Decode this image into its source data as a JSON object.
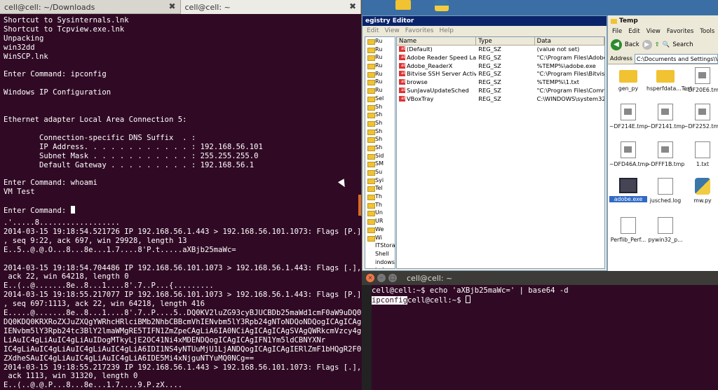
{
  "term1": {
    "tabs": [
      {
        "label": "cell@cell: ~/Downloads"
      },
      {
        "label": "cell@cell: ~"
      }
    ],
    "lines": [
      "Shortcut to Sysinternals.lnk",
      "Shortcut to Tcpview.exe.lnk",
      "Unpacking",
      "win32dd",
      "WinSCP.lnk",
      "",
      "Enter Command: ipconfig",
      "",
      "Windows IP Configuration",
      "",
      "",
      "Ethernet adapter Local Area Connection 5:",
      "",
      "        Connection-specific DNS Suffix  . :",
      "        IP Address. . . . . . . . . . . . : 192.168.56.101",
      "        Subnet Mask . . . . . . . . . . . : 255.255.255.0",
      "        Default Gateway . . . . . . . . . : 192.168.56.1",
      "",
      "Enter Command: whoami",
      "VM Test",
      "",
      "Enter Command: "
    ]
  },
  "term2": {
    "lines": [
      ".'.....8..................",
      "2014-03-15 19:18:54.521726 IP 192.168.56.1.443 > 192.168.56.101.1073: Flags [P.]",
      ", seq 9:22, ack 697, win 29928, length 13",
      "E..5..@.@.O...8...8e...1.7....8'P.t.....aXBjb25maWc=",
      "",
      "2014-03-15 19:18:54.704486 IP 192.168.56.101.1073 > 192.168.56.1.443: Flags [.],",
      " ack 22, win 64218, length 0",
      "E..(..@.......8e..8...1....8'.7..P...{.........",
      "2014-03-15 19:18:55.217077 IP 192.168.56.101.1073 > 192.168.56.1.443: Flags [P.]",
      ", seq 697:1113, ack 22, win 64218, length 416",
      "E.....@.......8e..8...1....8'.7..P....5..DQ0KV2luZG93cyBJUCBDb25maWd1cmF0aW9uDQ0K",
      "DQ0KDQ0KRXRoZXJuZXQgYWRhcHRlciBMb2NhbCBBcmVhIENvbm5lY3Rpb24gNToNDQoNDQogICAgICAg",
      "IENvbm5lY3Rpb24tc3BlY2lmaWMgRE5TIFN1ZmZpeCAgLiA6IA0NCiAgICAgICAgSVAgQWRkcmVzcy4g",
      "LiAuIC4gLiAuIC4gLiAuIDogMTkyLjE2OC41Ni4xMDENDQogICAgICAgIFN1Ym5ldCBNYXNr",
      "IC4gLiAuIC4gLiAuIC4gLiAuIC4gLiA6IDI1NS4yNTUuMjU1LjANDQogICAgICAgIERlZmF1bHQgR2F0",
      "ZXdheSAuIC4gLiAuIC4gLiAuIC4gLiA6IDE5Mi4xNjguNTYuMQ0NCg==",
      "2014-03-15 19:18:55.217239 IP 192.168.56.1.443 > 192.168.56.101.1073: Flags [.],",
      " ack 1113, win 31320, length 0",
      "E..(..@.@.P...8...8e...1.7....9.P.zX...."
    ]
  },
  "regedit": {
    "title": "egistry Editor",
    "menu": [
      "Edit",
      "View",
      "Favorites",
      "Help"
    ],
    "tree": [
      "Ru",
      "Ru",
      "Ru",
      "Ru",
      "Ru",
      "Ru",
      "Ru",
      "Sel",
      "Sh",
      "Sh",
      "Sh",
      "Sh",
      "Sh",
      "Sh",
      "Sid",
      "SM",
      "Su",
      "Syi",
      "Tel",
      "Th",
      "Th",
      "Un",
      "UR",
      "We",
      "Wi",
      "ITStora",
      "Shell",
      "indows G",
      "indows G",
      "indows M",
      "indows M",
      "indows M",
      "indows S",
      "indows S",
      "ndo",
      "ndo"
    ],
    "columns": [
      "Name",
      "Type",
      "Data"
    ],
    "rows": [
      {
        "name": "(Default)",
        "type": "REG_SZ",
        "data": "(value not set)"
      },
      {
        "name": "Adobe Reader Speed Lau...",
        "type": "REG_SZ",
        "data": "\"C:\\Program Files\\Adobe\\Re"
      },
      {
        "name": "Adobe_ReaderX",
        "type": "REG_SZ",
        "data": "%TEMP%\\adobe.exe"
      },
      {
        "name": "Bitvise SSH Server Activat...",
        "type": "REG_SZ",
        "data": "\"C:\\Program Files\\Bitvise SSH"
      },
      {
        "name": "browse",
        "type": "REG_SZ",
        "data": "%TEMP%\\1.txt"
      },
      {
        "name": "SunJavaUpdateSched",
        "type": "REG_SZ",
        "data": "\"C:\\Program Files\\Common F"
      },
      {
        "name": "VBoxTray",
        "type": "REG_SZ",
        "data": "C:\\WINDOWS\\system32\\VBo"
      }
    ]
  },
  "explorer": {
    "title": "Temp",
    "menu": [
      "File",
      "Edit",
      "View",
      "Favorites",
      "Tools",
      "H"
    ],
    "back_label": "Back",
    "search_label": "Search",
    "address_label": "Address",
    "address_value": "C:\\Documents and Settings\\VM",
    "files": [
      {
        "label": "gen_py",
        "kind": "folder"
      },
      {
        "label": "hsperfdata...Test",
        "kind": "folder"
      },
      {
        "label": "~DF20E6.tmp",
        "kind": "tmp"
      },
      {
        "label": "~DF214E.tmp",
        "kind": "tmp"
      },
      {
        "label": "~DF2141.tmp",
        "kind": "tmp"
      },
      {
        "label": "~DF2252.tmp",
        "kind": "tmp"
      },
      {
        "label": "~DFD46A.tmp",
        "kind": "tmp"
      },
      {
        "label": "~DFFF1B.tmp",
        "kind": "tmp"
      },
      {
        "label": "1.txt",
        "kind": "txt"
      },
      {
        "label": "adobe.exe",
        "kind": "exe"
      },
      {
        "label": "jusched.log",
        "kind": "txt"
      },
      {
        "label": "mw.py",
        "kind": "py"
      },
      {
        "label": "Perflib_Perf...",
        "kind": "txt"
      },
      {
        "label": "pywin32_p...",
        "kind": "txt"
      }
    ]
  },
  "term3": {
    "title": "cell@cell: ~",
    "line1": "cell@cell:~$ echo 'aXBjb25maWc=' | base64 -d",
    "decoded": "ipconfig",
    "prompt": "cell@cell:~$ "
  }
}
